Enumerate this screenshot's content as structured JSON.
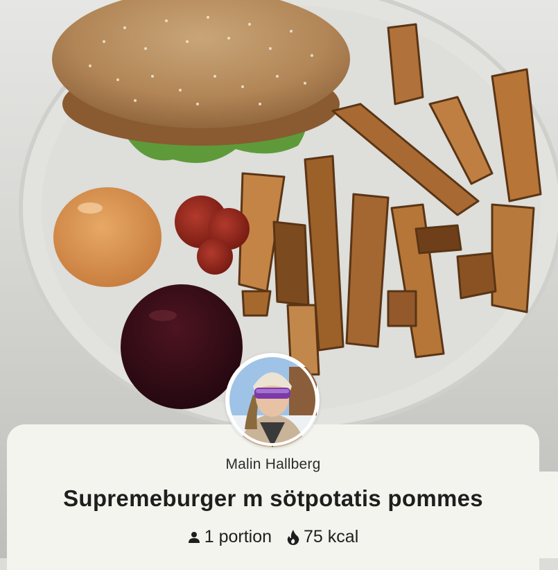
{
  "recipe": {
    "author_name": "Malin Hallberg",
    "title": "Supremeburger m sötpotatis pommes",
    "portions_label": "1 portion",
    "calories_label": "75 kcal"
  },
  "icons": {
    "portions": "person-icon",
    "calories": "flame-icon"
  },
  "colors": {
    "card_background": "#f4f4ee",
    "text_primary": "#1e1e1e"
  }
}
